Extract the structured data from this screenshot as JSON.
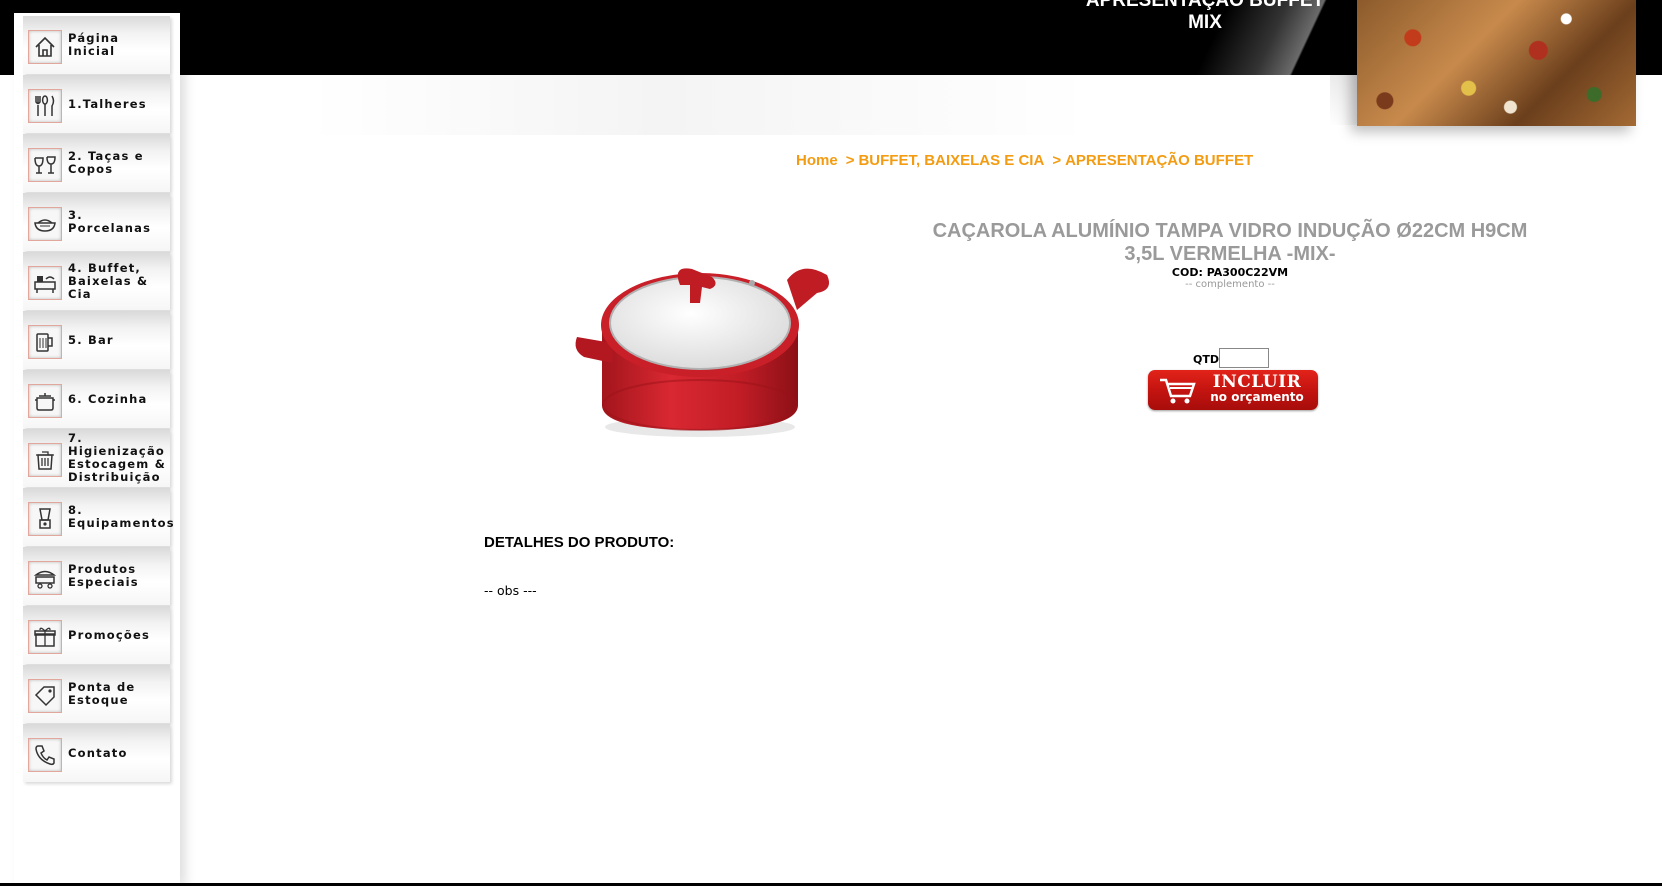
{
  "banner": {
    "title": "APRESENTAÇÃO BUFFET MIX"
  },
  "sidebar": {
    "items": [
      {
        "label": "Página Inicial",
        "icon": "home-icon"
      },
      {
        "label": "1.Talheres",
        "icon": "cutlery-icon"
      },
      {
        "label": "2. Taças e Copos",
        "icon": "glasses-icon"
      },
      {
        "label": "3. Porcelanas",
        "icon": "porcelain-bowl-icon"
      },
      {
        "label": "4. Buffet, Baixelas & Cia",
        "icon": "buffet-icon"
      },
      {
        "label": "5. Bar",
        "icon": "beer-mug-icon"
      },
      {
        "label": "6. Cozinha",
        "icon": "cooking-pot-icon"
      },
      {
        "label": "7. Higienização Estocagem & Distribuição",
        "icon": "trash-bin-icon"
      },
      {
        "label": "8. Equipamentos",
        "icon": "blender-icon"
      },
      {
        "label": "Produtos Especiais",
        "icon": "food-cart-icon"
      },
      {
        "label": "Promoções",
        "icon": "gift-box-icon"
      },
      {
        "label": "Ponta de Estoque",
        "icon": "tag-icon"
      },
      {
        "label": "Contato",
        "icon": "phone-icon"
      }
    ]
  },
  "breadcrumb": {
    "home": "Home",
    "category": "BUFFET, BAIXELAS E CIA",
    "subcategory": "APRESENTAÇÃO BUFFET",
    "separator": ">"
  },
  "product": {
    "title": "CAÇAROLA ALUMÍNIO TAMPA VIDRO INDUÇÃO Ø22CM H9CM 3,5L VERMELHA -MIX-",
    "code": "COD: PA300C22VM",
    "complement": "-- complemento --",
    "qty_label": "QTD",
    "qty_value": "",
    "add_button_main": "INCLUIR",
    "add_button_sub": "no orçamento",
    "details_title": "DETALHES DO PRODUTO:",
    "details_obs": "-- obs ---"
  },
  "colors": {
    "breadcrumb": "#f39c12",
    "title": "#9a9a9a",
    "button_red": "#c41410"
  }
}
